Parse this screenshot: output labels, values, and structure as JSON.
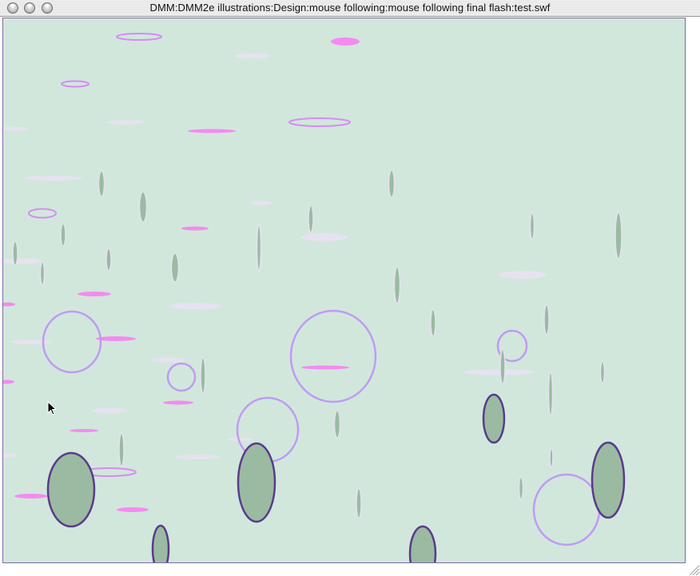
{
  "window": {
    "title": "DMM:DMM2e illustrations:Design:mouse following:mouse following final flash:test.swf",
    "buttons": [
      "close",
      "minimize",
      "zoom"
    ]
  },
  "colors": {
    "stage_background": "#d1e7dc",
    "green_fill": "#9abba1",
    "dark_purple_stroke": "#5b3a8c",
    "lavender_stroke": "#c299f5",
    "pink": "#f58af0",
    "pale_lavender": "#e6e2f0"
  },
  "icons": {
    "cursor": "arrow-pointer-icon",
    "resize": "grow-box-icon"
  }
}
